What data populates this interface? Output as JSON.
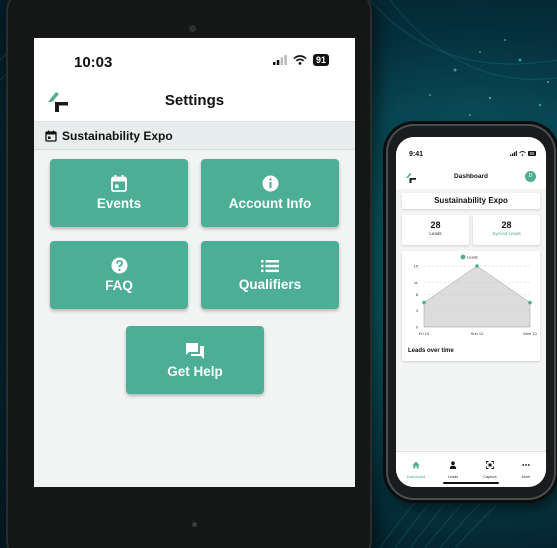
{
  "colors": {
    "accent": "#4dae96",
    "background": "#04222e"
  },
  "tablet": {
    "status": {
      "time": "10:03",
      "battery": "91"
    },
    "header": {
      "title": "Settings",
      "logo_icon": "logo-icon"
    },
    "event_bar": {
      "icon": "calendar-icon",
      "name": "Sustainability Expo"
    },
    "tiles": [
      {
        "label": "Events",
        "icon": "calendar-icon"
      },
      {
        "label": "Account Info",
        "icon": "info-icon"
      },
      {
        "label": "FAQ",
        "icon": "help-icon"
      },
      {
        "label": "Qualifiers",
        "icon": "list-icon"
      },
      {
        "label": "Get Help",
        "icon": "chat-icon"
      }
    ]
  },
  "phone": {
    "status": {
      "time": "9:41",
      "battery": "85"
    },
    "header": {
      "title": "Dashboard",
      "avatar": "D"
    },
    "event_name": "Sustainability Expo",
    "stats": [
      {
        "value": "28",
        "label": "Leads"
      },
      {
        "value": "28",
        "label": "Synced Leads"
      }
    ],
    "chart_title": "Leads over time",
    "tabs": [
      {
        "label": "Dashboard",
        "icon": "home-icon",
        "active": true
      },
      {
        "label": "Leads",
        "icon": "person-icon",
        "active": false
      },
      {
        "label": "Capture",
        "icon": "scan-icon",
        "active": false
      },
      {
        "label": "More",
        "icon": "more-icon",
        "active": false
      }
    ]
  },
  "chart_data": {
    "type": "area",
    "categories": [
      "Fri 10",
      "Sun 12",
      "Mon 13"
    ],
    "series": [
      {
        "name": "Leads",
        "values": [
          6,
          15,
          6
        ]
      }
    ],
    "y_ticks": [
      0,
      4,
      8,
      11,
      15
    ],
    "ylim": [
      0,
      15
    ],
    "title": "Leads over time",
    "legend": "top-center",
    "grid": true
  }
}
